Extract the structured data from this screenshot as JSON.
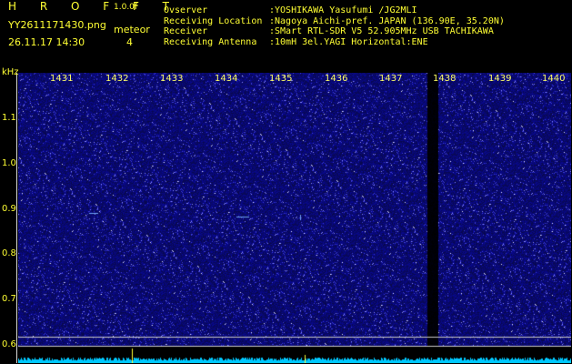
{
  "header": {
    "logo": "H R O F F T",
    "version": "1.0.0f",
    "filename": "YY2611171430.png",
    "timestamp": "26.11.17 14:30",
    "meteor_label": "meteor",
    "meteor_count": "4"
  },
  "info": {
    "observer_key": "Ovserver",
    "observer_val": ":YOSHIKAWA Yasufumi /JG2MLI",
    "location_key": "Receiving Location",
    "location_val": ":Nagoya Aichi-pref. JAPAN (136.90E, 35.20N)",
    "receiver_key": "Receiver",
    "receiver_val": ":SMart RTL-SDR V5 52.905MHz USB TACHIKAWA",
    "antenna_key": "Receiving Antenna",
    "antenna_val": ":10mH 3el.YAGI Horizontal:ENE"
  },
  "axis": {
    "unit": "kHz",
    "y_ticks": [
      "1.1",
      "1.0",
      "0.9",
      "0.8",
      "0.7",
      "0.6"
    ],
    "x_ticks": [
      "1431",
      "1432",
      "1433",
      "1434",
      "1435",
      "1436",
      "1437",
      "1438",
      "1439",
      "1440"
    ]
  },
  "colors": {
    "text": "#ffff33",
    "background": "#000000",
    "noise_base": "#14148c",
    "baseline_trace": "#00c8ff"
  }
}
